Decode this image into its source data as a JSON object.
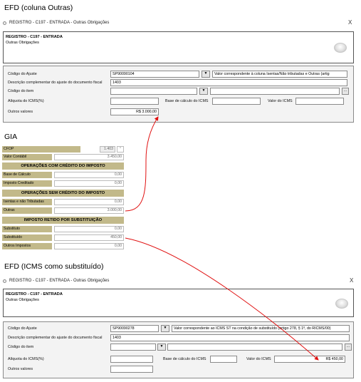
{
  "section1": {
    "heading": "EFD (coluna Outras)",
    "window_title": "REGISTRO - C197 - ENTRADA - Outras Obrigações",
    "close": "X",
    "header_title": "REGISTRO - C197 - ENTRADA",
    "header_subtitle": "Outras Obrigações",
    "codigo_ajuste_label": "Código do Ajuste",
    "codigo_ajuste_value": "SP90090104",
    "codigo_ajuste_desc": "Valor correspondente à coluna Isentas/Não tributadas e Outras (artig",
    "descricao_label": "Descrição complementar do ajuste do documento fiscal",
    "descricao_value": "1403",
    "codigo_item_label": "Código do item",
    "aliquota_label": "Alíquota do ICMS(%)",
    "base_label": "Base de cálculo do ICMS",
    "valor_icms_label": "Valor do ICMS",
    "outros_label": "Outros valores",
    "outros_value": "R$ 3.000,00"
  },
  "gia": {
    "heading": "GIA",
    "cfop_label": "CFOP",
    "cfop_value": "1.403",
    "valor_contabil_label": "Valor Contábil",
    "valor_contabil_value": "3.450,00",
    "sec_com_credito": "OPERAÇÕES COM CRÉDITO DO IMPOSTO",
    "base_calculo_label": "Base de Cálculo",
    "base_calculo_value": "0,00",
    "imposto_creditado_label": "Imposto Creditado",
    "imposto_creditado_value": "0,00",
    "sec_sem_credito": "OPERAÇÕES SEM CRÉDITO DO IMPOSTO",
    "isentas_label": "Isentas e não Tributadas",
    "isentas_value": "0,00",
    "outras_label": "Outras",
    "outras_value": "3.000,00",
    "sec_retido": "IMPOSTO RETIDO POR SUBSTITUIÇÃO",
    "substituto_label": "Substituto",
    "substituto_value": "0,00",
    "substituido_label": "Substituído",
    "substituido_value": "450,00",
    "outros_impostos_label": "Outros Impostos",
    "outros_impostos_value": "0,00"
  },
  "section2": {
    "heading": "EFD (ICMS como substituído)",
    "window_title": "REGISTRO - C197 - ENTRADA - Outras Obrigações",
    "close": "X",
    "header_title": "REGISTRO - C197 - ENTRADA",
    "header_subtitle": "Outras Obrigações",
    "codigo_ajuste_label": "Código do Ajuste",
    "codigo_ajuste_value": "SP90090278",
    "codigo_ajuste_desc": "Valor correspondente ao ICMS ST na condição de substituído (artigo 278, § 1º, do RICMS/00)",
    "descricao_label": "Descrição complementar do ajuste do documento fiscal",
    "descricao_value": "1403",
    "codigo_item_label": "Código do item",
    "aliquota_label": "Alíquota do ICMS(%)",
    "base_label": "Base de cálculo do ICMS",
    "valor_icms_label": "Valor do ICMS",
    "valor_icms_value": "R$ 450,00",
    "outros_label": "Outros valores"
  },
  "icons": {
    "dropdown": "▼",
    "ellipsis": "...",
    "spin": "⌃"
  },
  "colors": {
    "gia_label_bg": "#c2b98a",
    "arrow": "#e01010"
  }
}
